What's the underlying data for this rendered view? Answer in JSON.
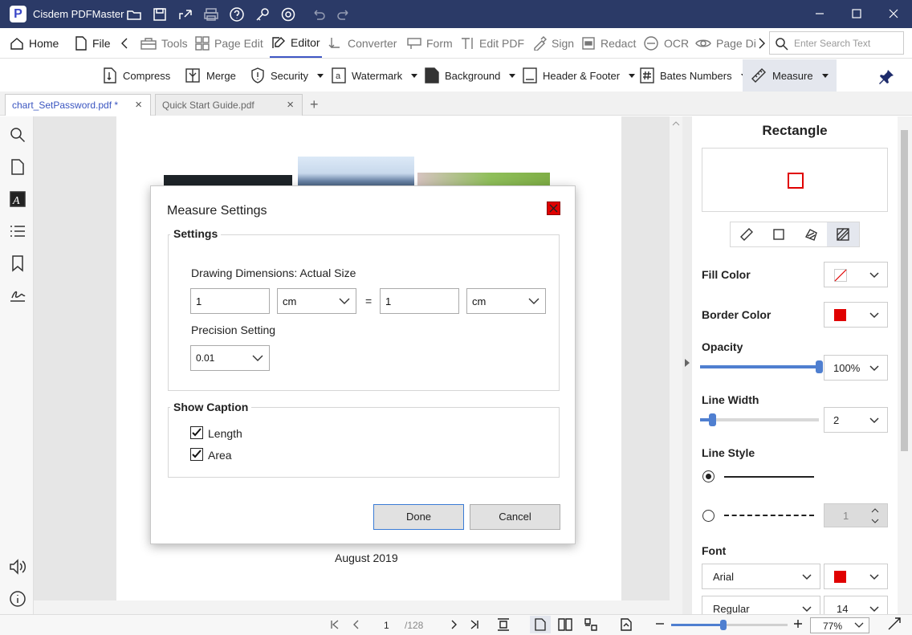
{
  "app": {
    "title": "Cisdem PDFMaster",
    "logo_letter": "P"
  },
  "menu": {
    "home": "Home",
    "file": "File",
    "tools": "Tools",
    "page_edit": "Page Edit",
    "editor": "Editor",
    "converter": "Converter",
    "form": "Form",
    "edit_pdf": "Edit PDF",
    "sign": "Sign",
    "redact": "Redact",
    "ocr": "OCR",
    "page_display": "Page Di"
  },
  "search": {
    "placeholder": "Enter Search Text"
  },
  "subtoolbar": {
    "compress": "Compress",
    "merge": "Merge",
    "security": "Security",
    "watermark": "Watermark",
    "background": "Background",
    "header_footer": "Header & Footer",
    "bates": "Bates Numbers",
    "measure": "Measure"
  },
  "tabs": [
    {
      "label": "chart_SetPassword.pdf *",
      "active": true
    },
    {
      "label": "Quick Start Guide.pdf",
      "active": false
    }
  ],
  "document": {
    "date_text": "August 2019"
  },
  "dialog": {
    "title": "Measure Settings",
    "settings_label": "Settings",
    "drawing_dimensions_label": "Drawing Dimensions: Actual Size",
    "left_value": "1",
    "left_unit": "cm",
    "equals": "=",
    "right_value": "1",
    "right_unit": "cm",
    "precision_label": "Precision Setting",
    "precision_value": "0.01",
    "show_caption_label": "Show Caption",
    "length_label": "Length",
    "area_label": "Area",
    "length_checked": true,
    "area_checked": true,
    "done_label": "Done",
    "cancel_label": "Cancel"
  },
  "panel": {
    "title": "Rectangle",
    "fill_color_label": "Fill Color",
    "border_color_label": "Border Color",
    "border_color": "#e00000",
    "opacity_label": "Opacity",
    "opacity_value": "100%",
    "opacity_level": 1.0,
    "line_width_label": "Line Width",
    "line_width_value": "2",
    "line_width_level": 0.1,
    "line_style_label": "Line Style",
    "dash_value": "1",
    "font_label": "Font",
    "font_value": "Arial",
    "font_color": "#e00000",
    "style_value": "Regular",
    "size_value": "14"
  },
  "status": {
    "page_current": "1",
    "page_total": "/128",
    "zoom_value": "77%",
    "zoom_level": 0.45
  },
  "colors": {
    "titlebar": "#2b3a67",
    "accent": "#3f57c4",
    "red": "#e00000"
  }
}
